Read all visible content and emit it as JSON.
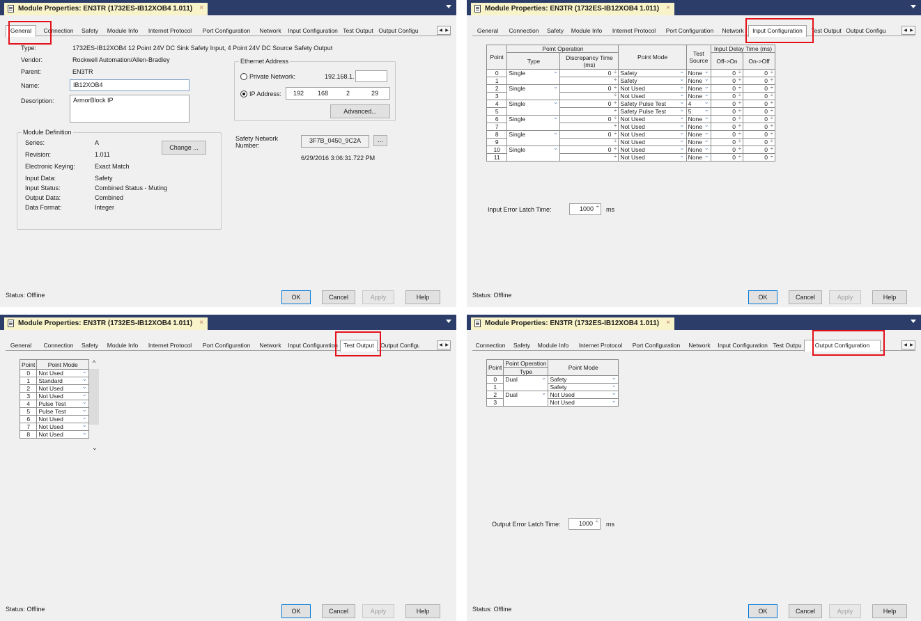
{
  "window_title": "Module Properties: EN3TR (1732ES-IB12XOB4 1.011)",
  "close_glyph": "×",
  "tabs_a": [
    "General",
    "Connection",
    "Safety",
    "Module Info",
    "Internet Protocol",
    "Port Configuration",
    "Network",
    "Input Configuration",
    "Test Output",
    "Output Configu"
  ],
  "tabs_d": [
    "Connection",
    "Safety",
    "Module Info",
    "Internet Protocol",
    "Port Configuration",
    "Network",
    "Input Configuration",
    "Test Outpu",
    "Output Configuration"
  ],
  "general": {
    "type_label": "Type:",
    "type_value": "1732ES-IB12XOB4 12 Point 24V DC Sink Safety Input, 4 Point 24V DC Source Safety Output",
    "vendor_label": "Vendor:",
    "vendor_value": "Rockwell Automation/Allen-Bradley",
    "parent_label": "Parent:",
    "parent_value": "EN3TR",
    "name_label": "Name:",
    "name_value": "IB12XOB4",
    "desc_label": "Description:",
    "desc_value": "ArmorBlock IP",
    "ethernet_title": "Ethernet Address",
    "private_label": "Private Network:",
    "private_value": "192.168.1.",
    "ip_label": "IP Address:",
    "ip1": "192",
    "ip2": "168",
    "ip3": "2",
    "ip4": "29",
    "advanced": "Advanced...",
    "moddef_title": "Module Definition",
    "series_label": "Series:",
    "series_value": "A",
    "revision_label": "Revision:",
    "revision_value": "1.011",
    "keying_label": "Electronic Keying:",
    "keying_value": "Exact Match",
    "indata_label": "Input Data:",
    "indata_value": "Safety",
    "instatus_label": "Input Status:",
    "instatus_value": "Combined Status - Muting",
    "outdata_label": "Output Data:",
    "outdata_value": "Combined",
    "format_label": "Data Format:",
    "format_value": "Integer",
    "change": "Change ...",
    "snn_label": "Safety Network Number:",
    "snn_value": "3F7B_0450_9C2A",
    "snn_btn": "...",
    "timestamp": "6/29/2016 3:06:31.722 PM"
  },
  "input_config": {
    "h_point": "Point",
    "h_pointop": "Point Operation",
    "h_type": "Type",
    "h_disc": "Discrepancy Time (ms)",
    "h_mode": "Point Mode",
    "h_test": "Test Source",
    "h_delay": "Input Delay Time (ms)",
    "h_offon": "Off->On",
    "h_onoff": "On->Off",
    "rows": [
      {
        "p": "0",
        "type": "Single",
        "disc": "0",
        "mode": "Safety",
        "test": "None",
        "off_on": "0",
        "on_off": "0"
      },
      {
        "p": "1",
        "type": "",
        "disc": "",
        "mode": "Safety",
        "test": "None",
        "off_on": "0",
        "on_off": "0"
      },
      {
        "p": "2",
        "type": "Single",
        "disc": "0",
        "mode": "Not Used",
        "test": "None",
        "off_on": "0",
        "on_off": "0"
      },
      {
        "p": "3",
        "type": "",
        "disc": "",
        "mode": "Not Used",
        "test": "None",
        "off_on": "0",
        "on_off": "0"
      },
      {
        "p": "4",
        "type": "Single",
        "disc": "0",
        "mode": "Safety Pulse Test",
        "test": "4",
        "off_on": "0",
        "on_off": "0"
      },
      {
        "p": "5",
        "type": "",
        "disc": "",
        "mode": "Safety Pulse Test",
        "test": "5",
        "off_on": "0",
        "on_off": "0"
      },
      {
        "p": "6",
        "type": "Single",
        "disc": "0",
        "mode": "Not Used",
        "test": "None",
        "off_on": "0",
        "on_off": "0"
      },
      {
        "p": "7",
        "type": "",
        "disc": "",
        "mode": "Not Used",
        "test": "None",
        "off_on": "0",
        "on_off": "0"
      },
      {
        "p": "8",
        "type": "Single",
        "disc": "0",
        "mode": "Not Used",
        "test": "None",
        "off_on": "0",
        "on_off": "0"
      },
      {
        "p": "9",
        "type": "",
        "disc": "",
        "mode": "Not Used",
        "test": "None",
        "off_on": "0",
        "on_off": "0"
      },
      {
        "p": "10",
        "type": "Single",
        "disc": "0",
        "mode": "Not Used",
        "test": "None",
        "off_on": "0",
        "on_off": "0"
      },
      {
        "p": "11",
        "type": "",
        "disc": "",
        "mode": "Not Used",
        "test": "None",
        "off_on": "0",
        "on_off": "0"
      }
    ],
    "latch_label": "Input Error Latch Time:",
    "latch_value": "1000",
    "latch_unit": "ms"
  },
  "test_output": {
    "h_point": "Point",
    "h_mode": "Point Mode",
    "rows": [
      {
        "p": "0",
        "mode": "Not Used"
      },
      {
        "p": "1",
        "mode": "Standard"
      },
      {
        "p": "2",
        "mode": "Not Used"
      },
      {
        "p": "3",
        "mode": "Not Used"
      },
      {
        "p": "4",
        "mode": "Pulse Test"
      },
      {
        "p": "5",
        "mode": "Pulse Test"
      },
      {
        "p": "6",
        "mode": "Not Used"
      },
      {
        "p": "7",
        "mode": "Not Used"
      },
      {
        "p": "8",
        "mode": "Not Used"
      }
    ]
  },
  "output_config": {
    "h_point": "Point",
    "h_pointop": "Point Operation",
    "h_type": "Type",
    "h_mode": "Point Mode",
    "rows": [
      {
        "p": "0",
        "type": "Dual",
        "mode": "Safety"
      },
      {
        "p": "1",
        "type": "",
        "mode": "Safety"
      },
      {
        "p": "2",
        "type": "Dual",
        "mode": "Not Used"
      },
      {
        "p": "3",
        "type": "",
        "mode": "Not Used"
      }
    ],
    "latch_label": "Output Error Latch Time:",
    "latch_value": "1000",
    "latch_unit": "ms"
  },
  "footer": {
    "status": "Status:  Offline",
    "ok": "OK",
    "cancel": "Cancel",
    "apply": "Apply",
    "help": "Help"
  },
  "colors": {
    "title_bar": "#2b3d68",
    "title_tab": "#f8f3c9",
    "highlight": "#e3101a",
    "focus_border": "#0078d7"
  }
}
